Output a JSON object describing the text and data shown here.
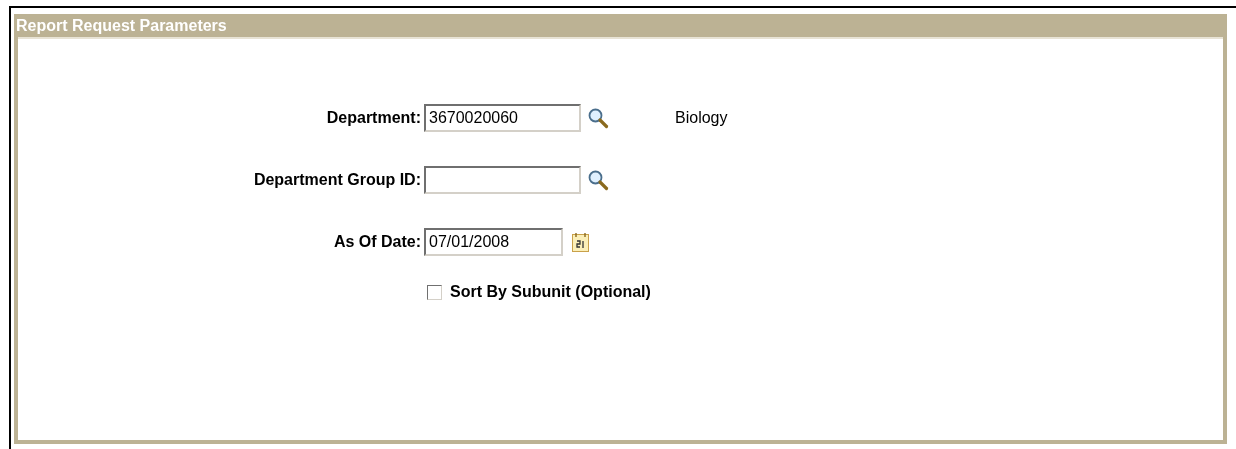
{
  "panel": {
    "title": "Report Request Parameters"
  },
  "fields": [
    {
      "kind": "lookup",
      "label": "Department:",
      "value": "3670020060",
      "description": "Biology"
    },
    {
      "kind": "lookup",
      "label": "Department Group ID:"
    },
    {
      "kind": "date",
      "label": "As Of Date:",
      "value": "07/01/2008"
    }
  ],
  "checkbox": {
    "label": "Sort By Subunit (Optional)",
    "checked": false
  }
}
